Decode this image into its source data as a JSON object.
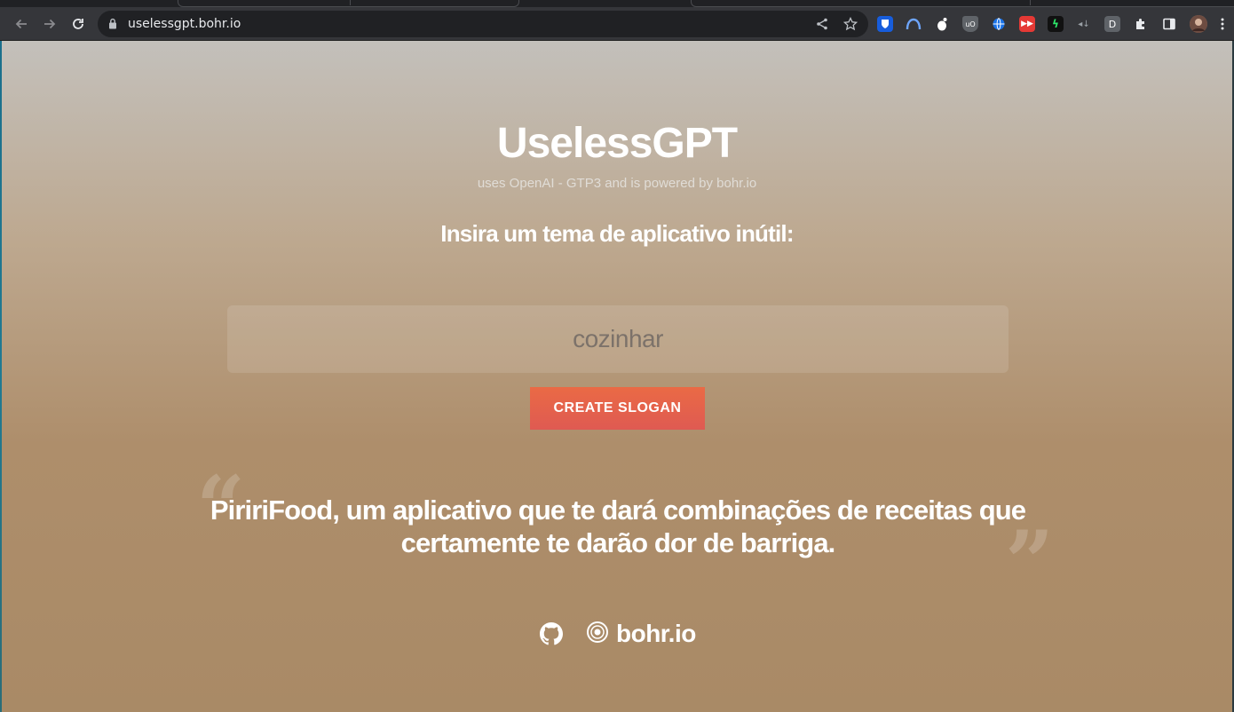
{
  "browser": {
    "url": "uselessgpt.bohr.io"
  },
  "page": {
    "title": "UselessGPT",
    "subtitle": "uses OpenAI - GTP3 and is powered by bohr.io",
    "prompt": "Insira um tema de aplicativo inútil:",
    "input": {
      "value": "cozinhar"
    },
    "button_label": "CREATE SLOGAN",
    "slogan": "PiririFood, um aplicativo que te dará combinações de receitas que certamente te darão dor de barriga.",
    "footer": {
      "bohr_label": "bohr.io"
    }
  },
  "colors": {
    "button": "#e6604a",
    "background_top": "#c3c0bb",
    "background_bottom": "#a98a66"
  }
}
